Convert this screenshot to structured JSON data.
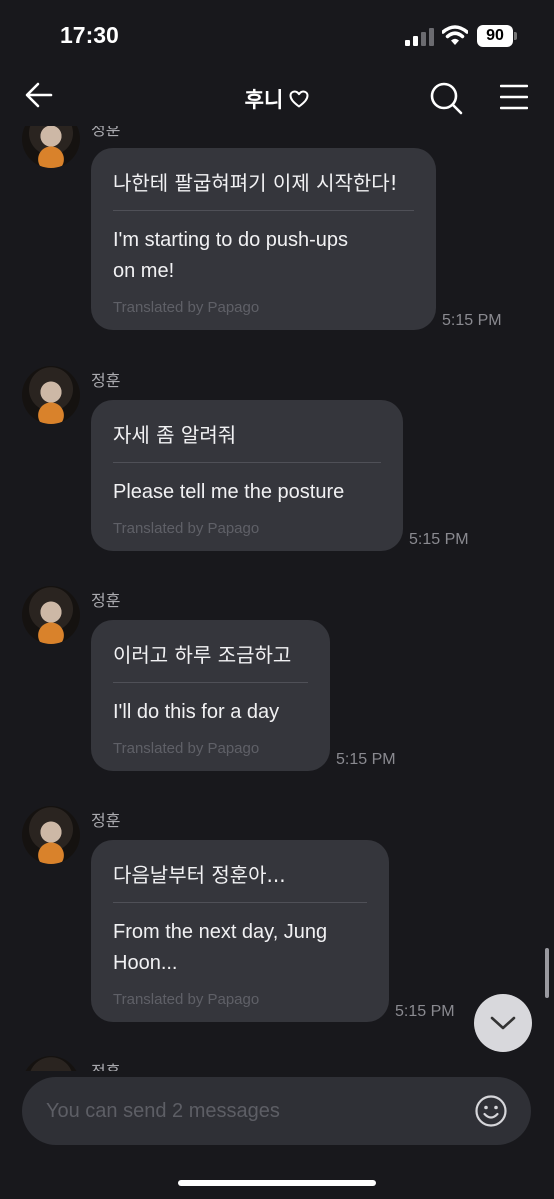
{
  "status": {
    "time": "17:30",
    "battery": "90"
  },
  "header": {
    "title": "후니",
    "heart_icon": "heart-outline-icon",
    "back_icon": "arrow-left-icon",
    "search_icon": "search-icon",
    "menu_icon": "menu-icon"
  },
  "messages": [
    {
      "sender": "정훈",
      "korean": "나한테 팔굽혀펴기 이제 시작한다!",
      "english_line1": "I'm starting to do push-ups",
      "english_line2": "on me!",
      "translated_by": "Translated by Papago",
      "time": "5:15 PM"
    },
    {
      "sender": "정훈",
      "korean": "자세 좀 알려줘",
      "english_line1": "Please tell me the posture",
      "english_line2": "",
      "translated_by": "Translated by Papago",
      "time": "5:15 PM"
    },
    {
      "sender": "정훈",
      "korean": "이러고 하루 조금하고",
      "english_line1": "I'll do this for a day",
      "english_line2": "",
      "translated_by": "Translated by Papago",
      "time": "5:15 PM"
    },
    {
      "sender": "정훈",
      "korean": "다음날부터 정훈아...",
      "english_line1": "From the next day, Jung",
      "english_line2": "Hoon...",
      "translated_by": "Translated by Papago",
      "time": "5:15 PM"
    },
    {
      "sender": "정훈"
    }
  ],
  "composer": {
    "placeholder": "You can send 2 messages",
    "emoji_icon": "smiley-icon"
  },
  "scroll_down_icon": "chevron-down-icon"
}
